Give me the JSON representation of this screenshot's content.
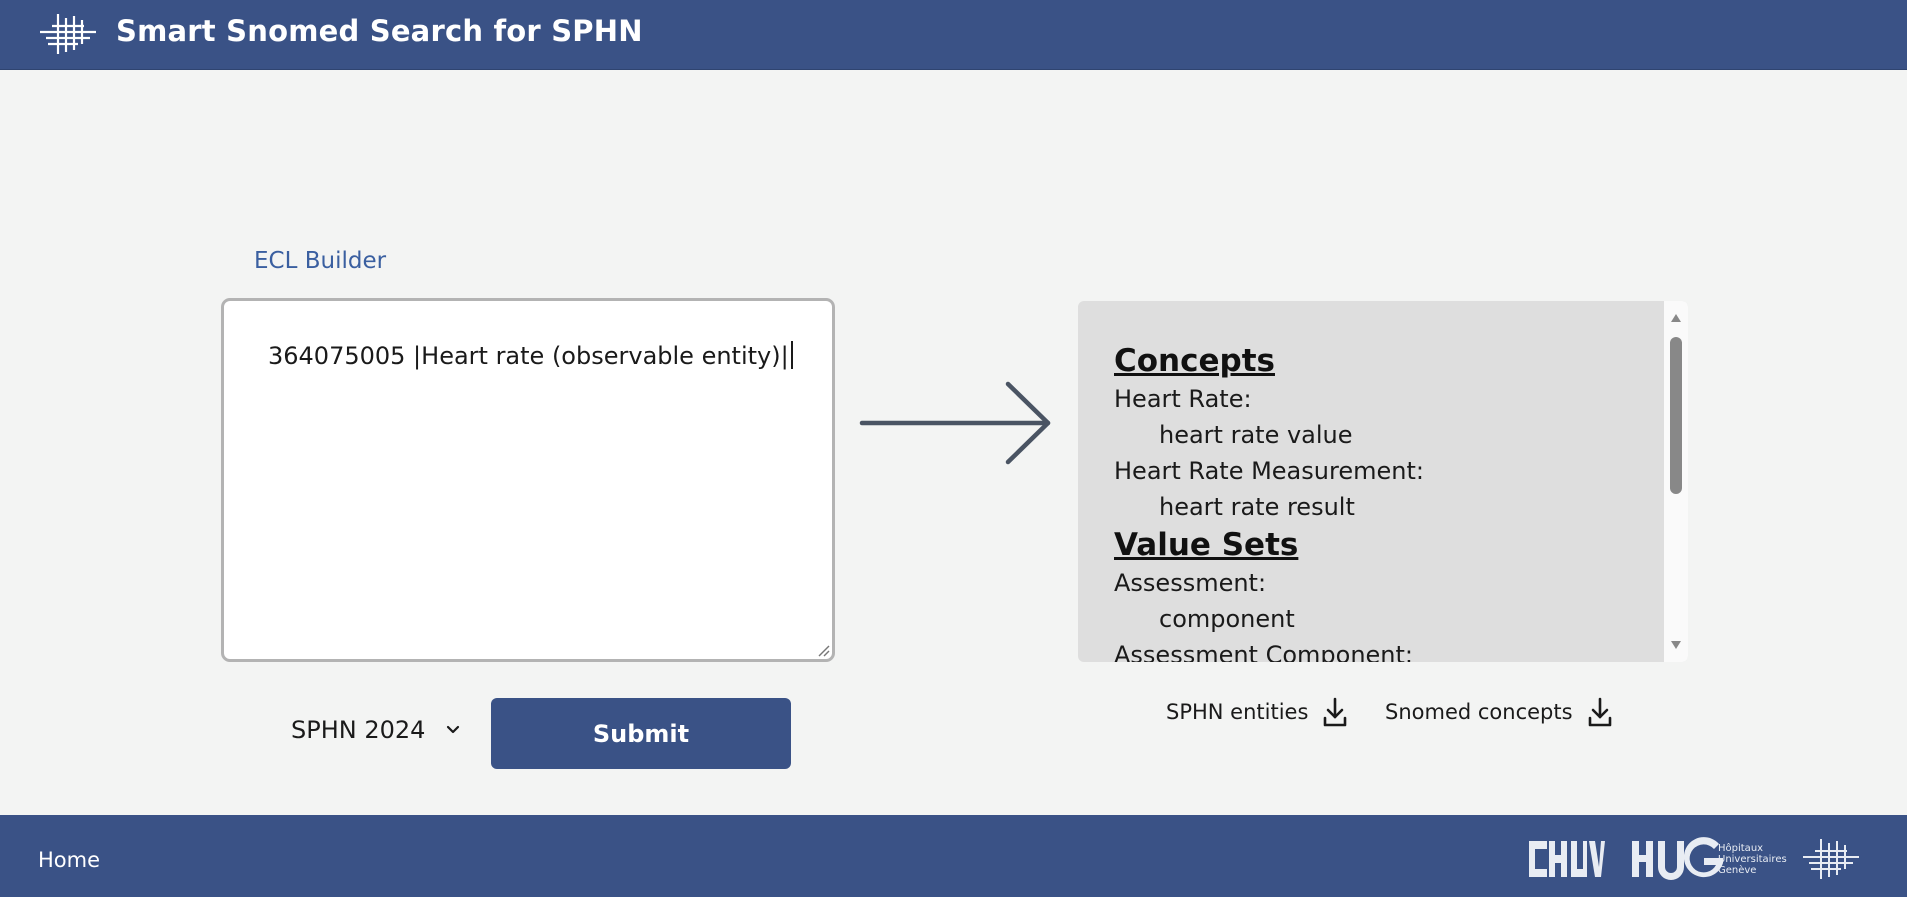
{
  "header": {
    "title": "Smart Snomed Search for SPHN"
  },
  "ecl_builder": {
    "label": "ECL Builder",
    "value": "364075005 |Heart rate (observable entity)|"
  },
  "version_select": {
    "selected": "SPHN 2024"
  },
  "submit_label": "Submit",
  "results": {
    "sections": [
      {
        "heading": "Concepts",
        "entries": [
          {
            "label": "Heart Rate:",
            "child": "heart rate value"
          },
          {
            "label": "Heart Rate Measurement:",
            "child": "heart rate result"
          }
        ]
      },
      {
        "heading": "Value Sets",
        "entries": [
          {
            "label": "Assessment:",
            "child": "component"
          },
          {
            "label": "Assessment Component:",
            "child": ""
          }
        ]
      }
    ]
  },
  "downloads": {
    "sphn_entities": "SPHN entities",
    "snomed_concepts": "Snomed concepts"
  },
  "footer": {
    "home": "Home",
    "hug_caption": [
      "Hôpitaux",
      "Universitaires",
      "Genève"
    ]
  },
  "colors": {
    "brand": "#3a5286",
    "label_blue": "#3a5fa0",
    "background": "#f3f4f3",
    "results_bg": "#dedede"
  }
}
